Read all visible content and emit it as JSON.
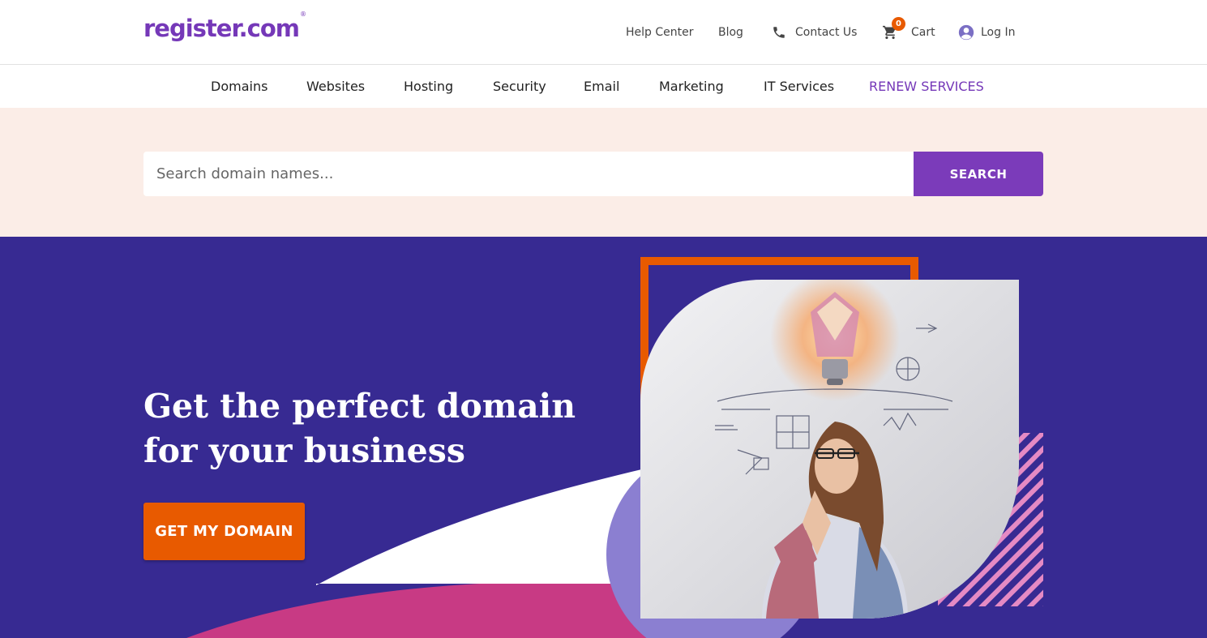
{
  "brand": {
    "logo_text": "register.com",
    "logo_mark": "®",
    "accent_color": "#7538b8",
    "cta_color": "#e85a00",
    "hero_color": "#372a92"
  },
  "utility_nav": {
    "help_center": "Help Center",
    "blog": "Blog",
    "contact_us": "Contact Us",
    "cart_label": "Cart",
    "cart_count": "0",
    "login": "Log In"
  },
  "main_nav": {
    "items": [
      "Domains",
      "Websites",
      "Hosting",
      "Security",
      "Email",
      "Marketing",
      "IT Services",
      "RENEW SERVICES"
    ]
  },
  "search": {
    "placeholder": "Search domain names...",
    "value": "",
    "button_label": "SEARCH"
  },
  "hero": {
    "headline_line1": "Get the perfect domain",
    "headline_line2": "for your business",
    "cta_label": "GET MY DOMAIN"
  },
  "icons": {
    "phone": "phone-icon",
    "cart": "cart-icon",
    "user": "user-circle-icon",
    "hero_image": "thinking-woman-lightbulb-illustration"
  }
}
